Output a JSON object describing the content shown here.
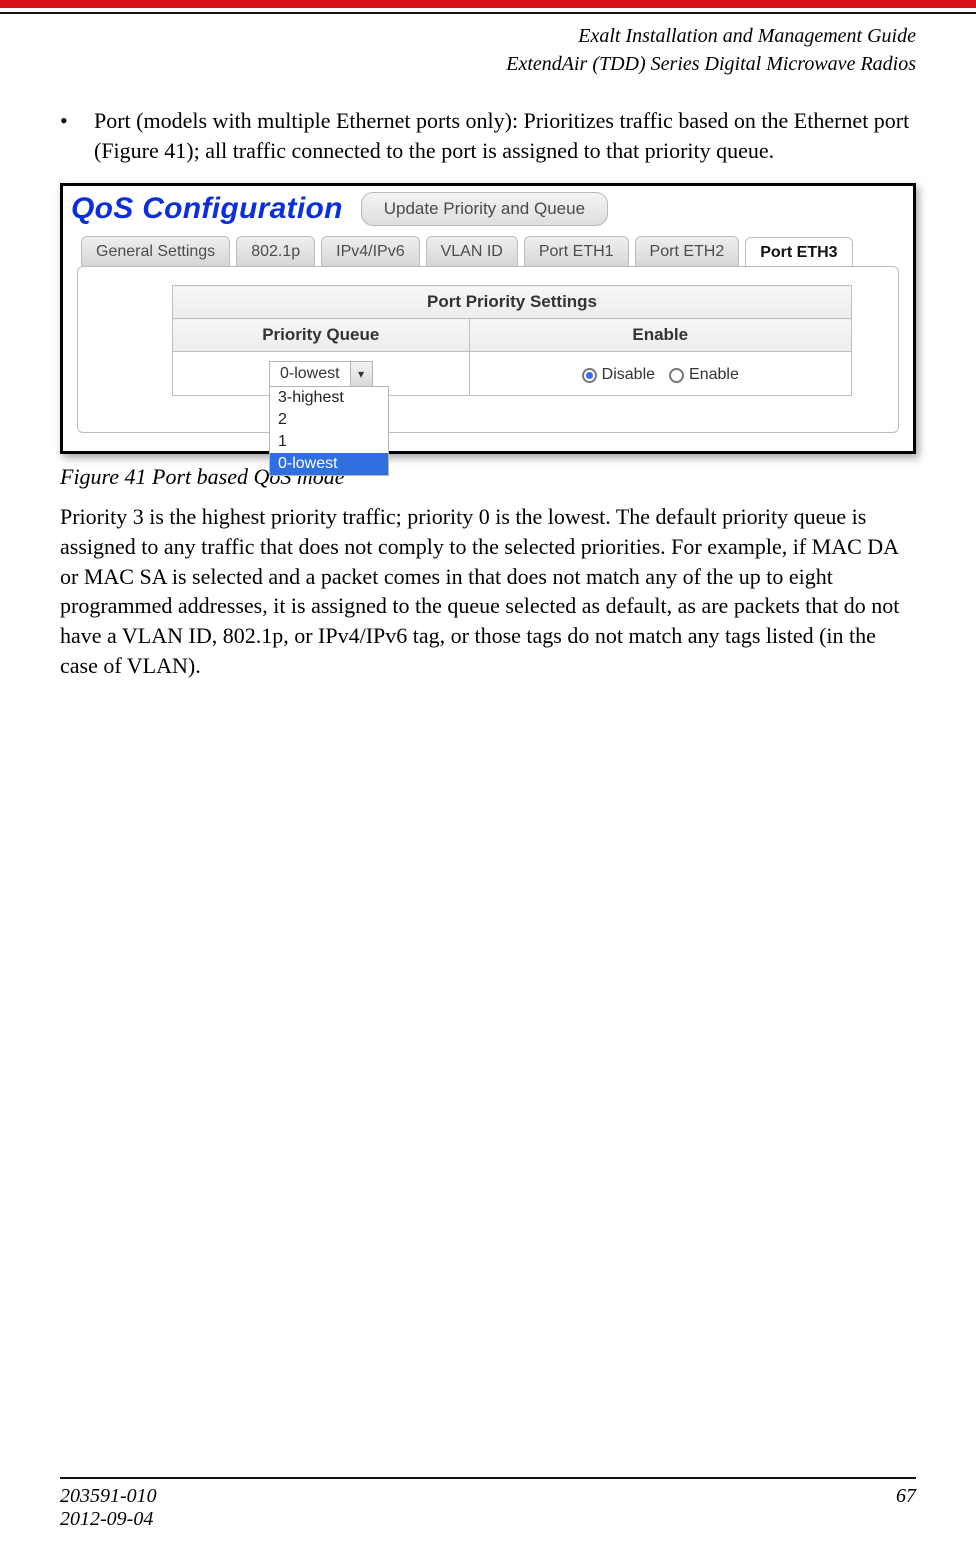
{
  "header": {
    "title": "Exalt Installation and Management Guide",
    "subtitle": "ExtendAir (TDD) Series Digital Microwave Radios"
  },
  "bullet": {
    "text": "Port (models with multiple Ethernet ports only): Prioritizes traffic based on the Ethernet port (Figure 41); all traffic connected to the port is assigned to that priority queue."
  },
  "ui": {
    "title": "QoS Configuration",
    "update_button": "Update Priority and Queue",
    "tabs": [
      "General Settings",
      "802.1p",
      "IPv4/IPv6",
      "VLAN ID",
      "Port ETH1",
      "Port ETH2",
      "Port ETH3"
    ],
    "active_tab": "Port ETH3",
    "table": {
      "caption": "Port Priority Settings",
      "headers": [
        "Priority Queue",
        "Enable"
      ],
      "selected": "0-lowest",
      "options": [
        "3-highest",
        "2",
        "1",
        "0-lowest"
      ],
      "radio": [
        "Disable",
        "Enable"
      ],
      "radio_selected": "Disable"
    }
  },
  "figure": {
    "caption": "Figure 41   Port based QoS mode"
  },
  "body": {
    "paragraph": "Priority 3 is the highest priority traffic; priority 0 is the lowest. The default priority queue is assigned to any traffic that does not comply to the selected priorities. For example, if MAC DA or MAC SA is selected and a packet comes in that does not match any of the up to eight programmed addresses, it is assigned to the queue selected as default, as are packets that do not have a VLAN ID, 802.1p, or IPv4/IPv6 tag, or those tags do not match any tags listed (in the case of VLAN)."
  },
  "footer": {
    "doc_number": "203591-010",
    "date": "2012-09-04",
    "page": "67"
  }
}
